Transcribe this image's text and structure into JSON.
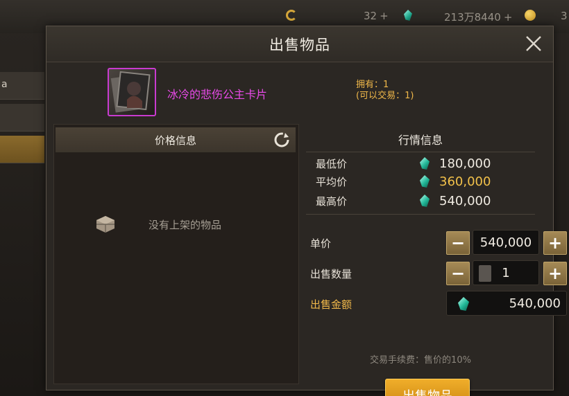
{
  "background": {
    "currencies": [
      {
        "value": "32",
        "icon": "moon-coin-icon"
      },
      {
        "value": "213万8440",
        "icon": "green-gem-icon"
      },
      {
        "value": "3",
        "icon": "gold-coin-icon"
      }
    ],
    "sidebar_partial_text": "a"
  },
  "dialog": {
    "title": "出售物品",
    "close_icon": "close-icon"
  },
  "item": {
    "name": "冰冷的悲伤公主卡片",
    "owned_line1": "拥有：1",
    "owned_line2": "(可以交易：1)",
    "rarity_color": "#c93bd0"
  },
  "price_info": {
    "header": "价格信息",
    "empty_text": "没有上架的物品"
  },
  "market": {
    "title": "行情信息",
    "rows": [
      {
        "label": "最低价",
        "value": "180,000"
      },
      {
        "label": "平均价",
        "value": "360,000"
      },
      {
        "label": "最高价",
        "value": "540,000"
      }
    ]
  },
  "form": {
    "unit_price_label": "单价",
    "unit_price": "540,000",
    "quantity_label": "出售数量",
    "quantity": "1",
    "total_label": "出售金额",
    "total": "540,000",
    "minus": "−",
    "plus": "+",
    "fee_text": "交易手续费：售价的10%",
    "sell_button": "出售物品"
  },
  "colors": {
    "accent_gold": "#f0b84a",
    "sell_button": "#e29a1f",
    "rarity_purple": "#e84ae8"
  }
}
